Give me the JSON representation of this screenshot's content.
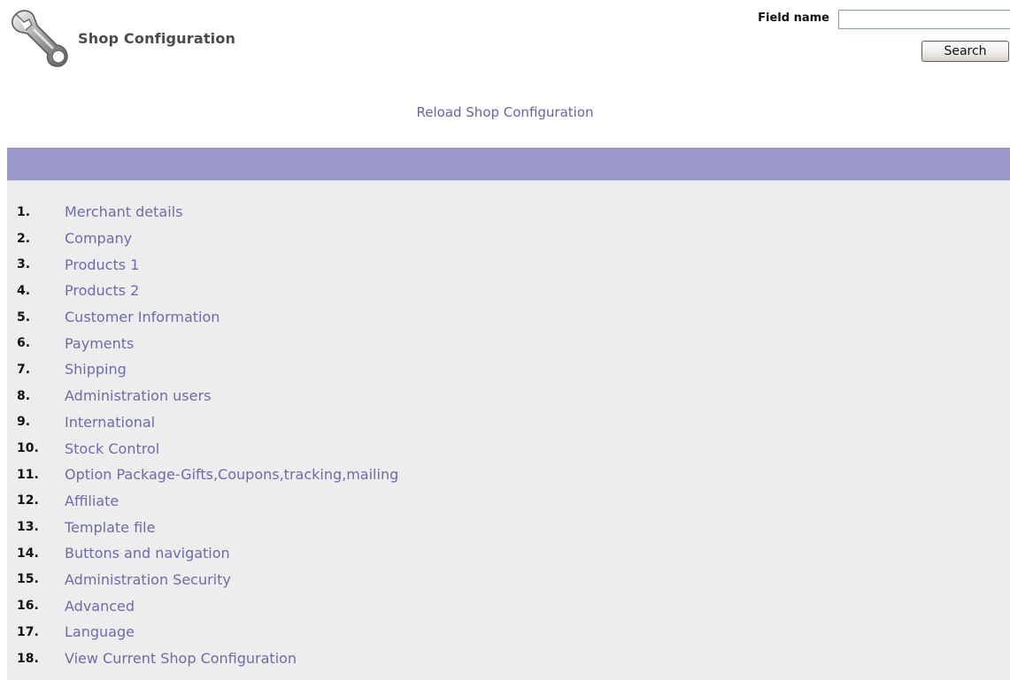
{
  "header": {
    "title": "Shop Configuration",
    "logo_icon": "wrench-icon"
  },
  "search": {
    "field_label": "Field name",
    "value": "",
    "placeholder": "",
    "button_label": "Search"
  },
  "reload_link": "Reload Shop Configuration",
  "colors": {
    "bar": "#9a98cb",
    "panel": "#ededed",
    "link": "#6d6bb0"
  },
  "menu": {
    "items": [
      {
        "number": "1.",
        "label": "Merchant details"
      },
      {
        "number": "2.",
        "label": "Company"
      },
      {
        "number": "3.",
        "label": "Products 1"
      },
      {
        "number": "4.",
        "label": "Products 2"
      },
      {
        "number": "5.",
        "label": "Customer Information"
      },
      {
        "number": "6.",
        "label": "Payments"
      },
      {
        "number": "7.",
        "label": "Shipping"
      },
      {
        "number": "8.",
        "label": "Administration users"
      },
      {
        "number": "9.",
        "label": "International"
      },
      {
        "number": "10.",
        "label": "Stock Control"
      },
      {
        "number": "11.",
        "label": "Option Package-Gifts,Coupons,tracking,mailing"
      },
      {
        "number": "12.",
        "label": "Affiliate"
      },
      {
        "number": "13.",
        "label": "Template file"
      },
      {
        "number": "14.",
        "label": "Buttons and navigation"
      },
      {
        "number": "15.",
        "label": "Administration Security"
      },
      {
        "number": "16.",
        "label": "Advanced"
      },
      {
        "number": "17.",
        "label": "Language"
      },
      {
        "number": "18.",
        "label": "View Current Shop Configuration"
      }
    ]
  }
}
